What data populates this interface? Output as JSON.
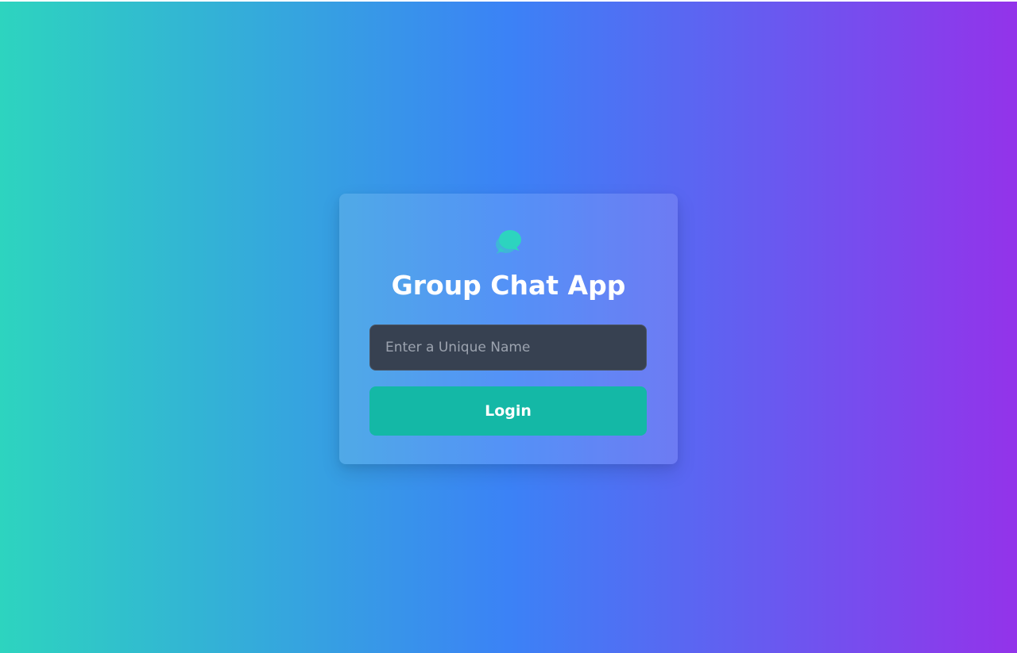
{
  "app": {
    "title": "Group Chat App",
    "logo_icon": "chat-bubbles-icon"
  },
  "login_form": {
    "name_input": {
      "value": "",
      "placeholder": "Enter a Unique Name"
    },
    "login_label": "Login"
  },
  "colors": {
    "background_gradient": [
      "#2dd4bf",
      "#3b82f6",
      "#9333ea"
    ],
    "card_background": "rgba(255,255,255,0.13)",
    "input_background": "#374151",
    "button_background": "#14b8a6",
    "logo_color": "#2dd4bf",
    "title_color": "#ffffff"
  }
}
